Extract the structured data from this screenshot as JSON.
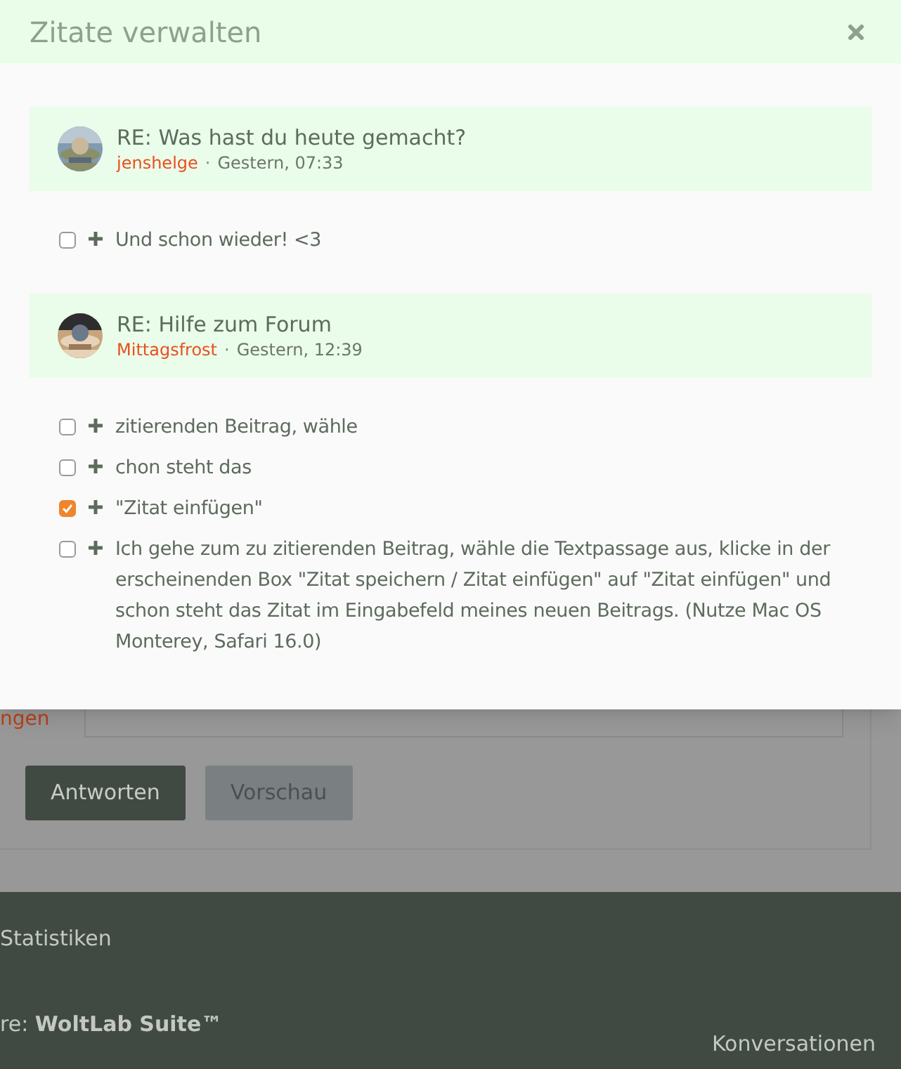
{
  "dialog": {
    "title": "Zitate verwalten",
    "groups": [
      {
        "title": "RE: Was hast du heute gemacht?",
        "author": "jenshelge",
        "separator": "·",
        "time": "Gestern, 07:33",
        "quotes": [
          {
            "text": "Und schon wieder! <3",
            "checked": false
          }
        ]
      },
      {
        "title": "RE: Hilfe zum Forum",
        "author": "Mittagsfrost",
        "separator": "·",
        "time": "Gestern, 12:39",
        "quotes": [
          {
            "text": "zitierenden Beitrag, wähle",
            "checked": false
          },
          {
            "text": "chon steht das",
            "checked": false
          },
          {
            "text": "\"Zitat einfügen\"",
            "checked": true
          },
          {
            "text": "Ich gehe zum zu zitierenden Beitrag, wähle die Textpassage aus, klicke in der erscheinenden Box \"Zitat speichern / Zitat einfügen\" auf \"Zitat einfügen\" und schon steht das Zitat im Eingabefeld meines neuen Beitrags. (Nutze Mac OS Monterey, Safari 16.0)",
            "checked": false
          }
        ]
      }
    ]
  },
  "form": {
    "field_label": "ngen",
    "buttons": [
      {
        "label": "Antworten",
        "kind": "primary"
      },
      {
        "label": "Vorschau",
        "kind": "secondary"
      }
    ]
  },
  "footer": {
    "link": "Statistiken",
    "credit": "re: **WoltLab Suite™**",
    "right_link": "Konversationen"
  }
}
